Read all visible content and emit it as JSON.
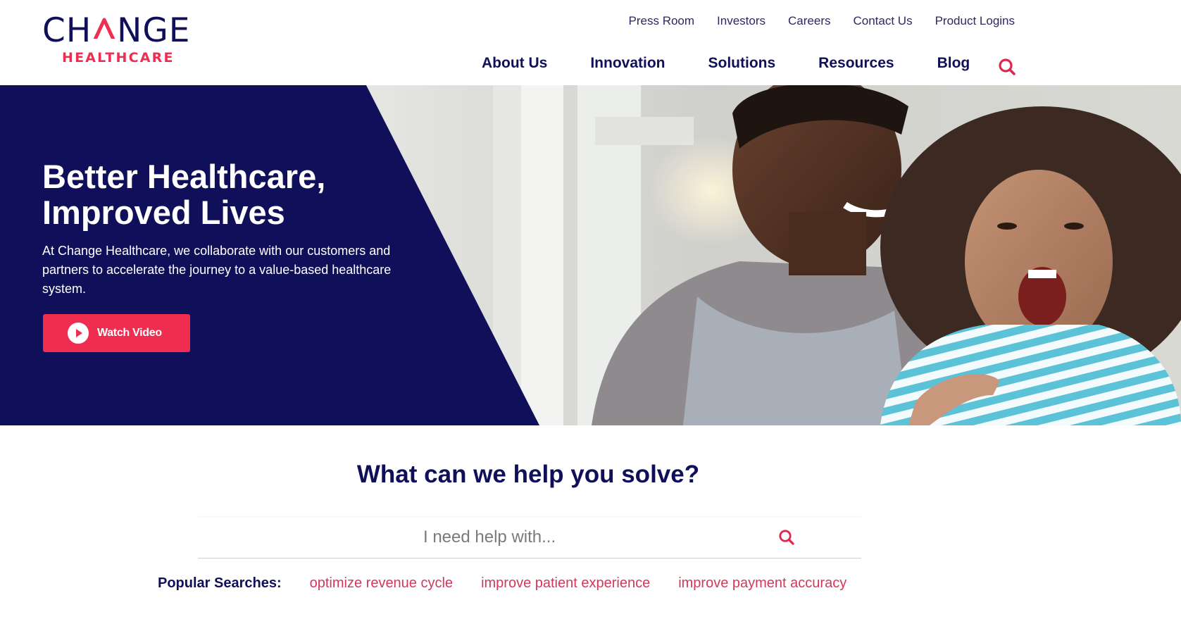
{
  "brand": {
    "logo_top": "CH",
    "logo_top_end": "NGE",
    "logo_bottom": "HEALTHCARE",
    "navy": "#10105a",
    "accent": "#ef2d50",
    "link_color": "#d4375a"
  },
  "utility_nav": [
    {
      "label": "Press Room"
    },
    {
      "label": "Investors"
    },
    {
      "label": "Careers"
    },
    {
      "label": "Contact Us"
    },
    {
      "label": "Product Logins"
    }
  ],
  "main_nav": [
    {
      "label": "About Us"
    },
    {
      "label": "Innovation"
    },
    {
      "label": "Solutions"
    },
    {
      "label": "Resources"
    },
    {
      "label": "Blog"
    }
  ],
  "header_search_icon": "search-icon",
  "hero": {
    "title_line1": "Better Healthcare,",
    "title_line2": "Improved Lives",
    "text": "At Change Healthcare, we collaborate with our customers and partners to accelerate the journey to a value-based healthcare system.",
    "button_label": "Watch Video",
    "button_icon": "play-circle-icon",
    "image_description": "Smiling father with laughing young daughter"
  },
  "solve": {
    "title": "What can we help you solve?",
    "search_placeholder": "I need help with...",
    "search_value": "",
    "popular_label": "Popular Searches:",
    "popular_links": [
      {
        "label": "optimize revenue cycle"
      },
      {
        "label": "improve patient experience"
      },
      {
        "label": "improve payment accuracy"
      }
    ]
  }
}
